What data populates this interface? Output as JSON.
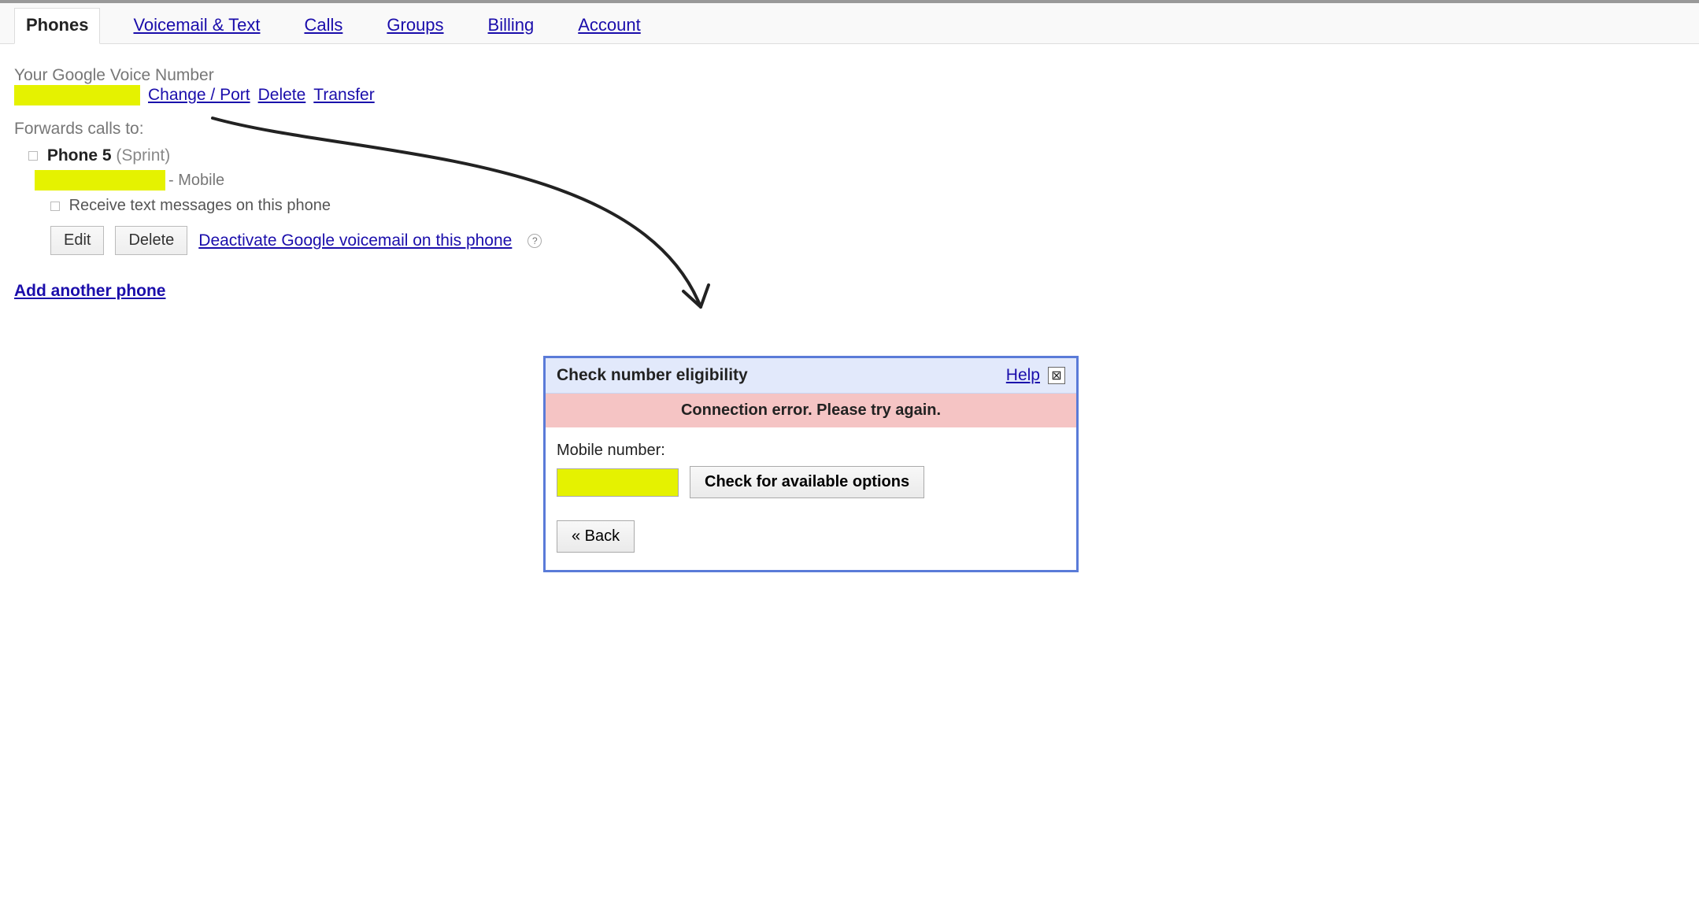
{
  "tabs": {
    "phones": "Phones",
    "voicemail": "Voicemail & Text",
    "calls": "Calls",
    "groups": "Groups",
    "billing": "Billing",
    "account": "Account"
  },
  "section": {
    "number_label": "Your Google Voice Number",
    "change_port": "Change / Port",
    "delete": "Delete",
    "transfer": "Transfer",
    "forwards_label": "Forwards calls to:",
    "add_phone": "Add another phone"
  },
  "phone": {
    "name": "Phone 5",
    "carrier": "(Sprint)",
    "type_suffix": "- Mobile",
    "receive_text": "Receive text messages on this phone",
    "edit": "Edit",
    "delete": "Delete",
    "deactivate": "Deactivate Google voicemail on this phone",
    "help_glyph": "?"
  },
  "dialog": {
    "title": "Check number eligibility",
    "help": "Help",
    "close_glyph": "⊠",
    "error": "Connection error. Please try again.",
    "mobile_label": "Mobile number:",
    "check_button": "Check for available options",
    "back_button": "« Back"
  }
}
